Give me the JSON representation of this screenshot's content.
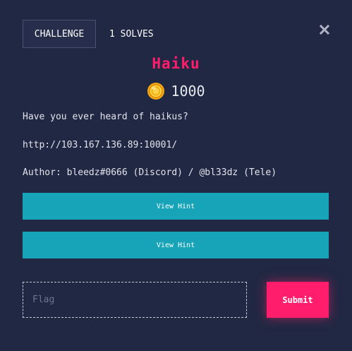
{
  "tabs": {
    "challenge_label": "CHALLENGE",
    "solves_label": "1 SOLVES"
  },
  "challenge": {
    "name": "Haiku",
    "value": "1000",
    "description": "Have you ever heard of haikus?",
    "url": "http://103.167.136.89:10001/",
    "author": "Author: bleedz#0666 (Discord) / @bl33dz (Tele)"
  },
  "hints": [
    {
      "label": "View Hint"
    },
    {
      "label": "View Hint"
    }
  ],
  "flag": {
    "placeholder": "Flag",
    "value": ""
  },
  "submit": {
    "label": "Submit"
  },
  "icons": {
    "close": "close-icon",
    "coin": "coin-icon"
  },
  "colors": {
    "background": "#212843",
    "accent": "#ff1d6c",
    "hint_button": "#17a3b8"
  }
}
